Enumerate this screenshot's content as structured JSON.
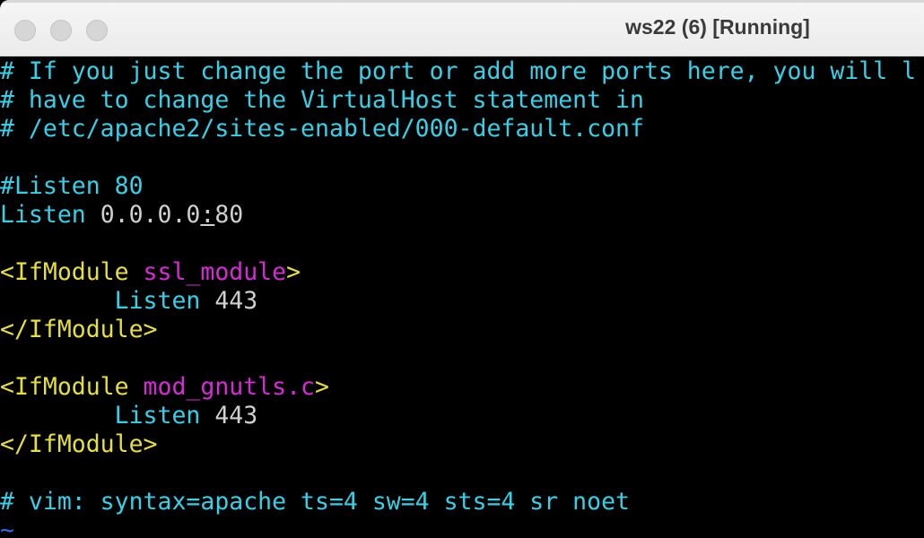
{
  "window": {
    "title": "ws22 (6) [Running]"
  },
  "colors": {
    "comment": "#34d1e8",
    "value": "#cfcfcf",
    "tag": "#e6df3c",
    "module": "#d62bd6",
    "tilde": "#2f6bf0"
  },
  "terminal": {
    "line1": "# If you just change the port or add more ports here, you will l",
    "line2": "# have to change the VirtualHost statement in",
    "line3": "# /etc/apache2/sites-enabled/000-default.conf",
    "line5": "#Listen 80",
    "line6_keyword": "Listen",
    "line6_value_a": " 0.0.0.0",
    "line6_cursor": ":",
    "line6_value_b": "80",
    "line8_open": "<IfModule",
    "line8_module": " ssl_module",
    "line8_close": ">",
    "line9_indent": "        ",
    "line9_keyword": "Listen",
    "line9_value": " 443",
    "line10": "</IfModule>",
    "line12_open": "<IfModule",
    "line12_module": " mod_gnutls.c",
    "line12_close": ">",
    "line13_indent": "        ",
    "line13_keyword": "Listen",
    "line13_value": " 443",
    "line14": "</IfModule>",
    "line16": "# vim: syntax=apache ts=4 sw=4 sts=4 sr noet",
    "line17": "~"
  }
}
